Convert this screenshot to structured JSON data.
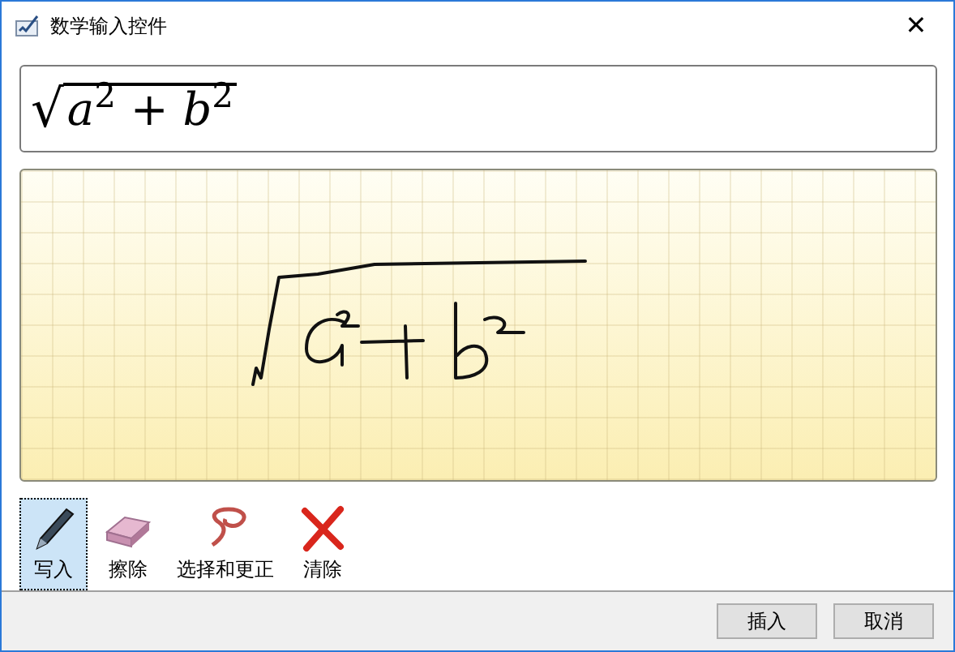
{
  "window": {
    "title": "数学输入控件",
    "close": "✕"
  },
  "preview": {
    "radical": "√",
    "radicand": "*a*$^{2}$ + *b*$^{2}$"
  },
  "tools": [
    {
      "kind": "pen",
      "label": "写入",
      "selected": true
    },
    {
      "kind": "eraser",
      "label": "擦除",
      "selected": false
    },
    {
      "kind": "lasso",
      "label": "选择和更正",
      "selected": false
    },
    {
      "kind": "clear",
      "label": "清除",
      "selected": false
    }
  ],
  "buttons": [
    "插入",
    "取消"
  ]
}
